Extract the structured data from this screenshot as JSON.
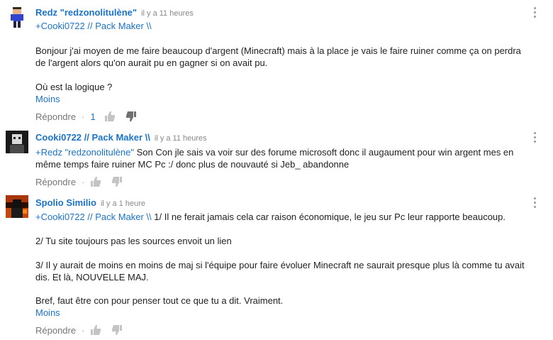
{
  "comments": [
    {
      "author": "Redz \"redzonolitulène\"",
      "time": "il y a 11 heures",
      "mention": "+Cooki0722 // Pack Maker \\\\",
      "lines": [
        "Bonjour j'ai moyen de me faire beaucoup d'argent (Minecraft) mais à la place je vais le faire ruiner comme ça on perdra",
        "de l'argent alors qu'on aurait pu en gagner si on avait pu.",
        "Où est la logique ?"
      ],
      "moins": "Moins",
      "reply_label": "Répondre",
      "reply_count": "1"
    },
    {
      "author": "Cooki0722 // Pack Maker \\\\",
      "time": "il y a 11 heures",
      "mention": "+Redz \"redzonolitulène\"",
      "lines": [
        " Son Con jle sais va voir sur des forume microsoft donc il augaument pour win argent mes en",
        "même temps faire ruiner MC Pc :/ donc plus de nouvauté si Jeb_ abandonne"
      ],
      "reply_label": "Répondre"
    },
    {
      "author": "Spolio Similio",
      "time": "il y a 1 heure",
      "mention": "+Cooki0722 // Pack Maker \\\\",
      "lines": [
        " 1/ Il ne ferait jamais cela car raison économique, le jeu sur Pc leur rapporte beaucoup.",
        "2/ Tu site toujours pas les sources envoit un lien",
        "3/ Il y aurait de moins en moins de maj si l'équipe pour faire évoluer Minecraft ne saurait presque plus là comme tu avait",
        "dis. Et là, NOUVELLE MAJ.",
        "Bref, faut être con pour penser tout ce que tu a dit. Vraiment."
      ],
      "moins": "Moins",
      "reply_label": "Répondre"
    }
  ],
  "icons": {
    "like": "thumbs-up-icon",
    "dislike": "thumbs-down-icon",
    "menu": "vertical-ellipsis-icon"
  },
  "colors": {
    "link": "#1a73c8",
    "muted": "#767676",
    "text": "#222222"
  }
}
